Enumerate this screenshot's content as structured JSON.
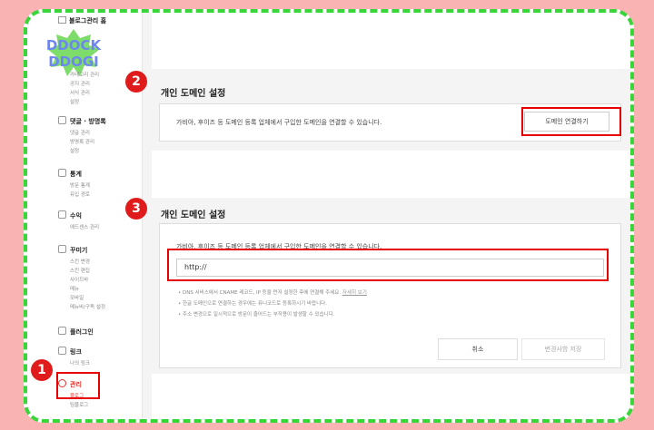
{
  "colors": {
    "accent": "#e01b1b",
    "dash_border": "#39d639",
    "background": "#f9b3b3"
  },
  "sidebar": {
    "home_label": "블로그관리 홈",
    "logo_lines": [
      "DDOCK",
      "DDOGI"
    ],
    "sections": [
      {
        "title": "",
        "items": [
          "카테고리 관리",
          "공지 관리",
          "서식 관리",
          "설정"
        ]
      },
      {
        "title": "댓글 · 방명록",
        "items": [
          "댓글 관리",
          "방명록 관리",
          "설정"
        ]
      },
      {
        "title": "통계",
        "items": [
          "방문 통계",
          "유입 경로"
        ]
      },
      {
        "title": "수익",
        "items": [
          "애드센스 관리"
        ]
      },
      {
        "title": "꾸미기",
        "items": [
          "스킨 변경",
          "스킨 편집",
          "사이드바",
          "메뉴",
          "모바일",
          "메뉴바/구독 설정"
        ]
      },
      {
        "title": "플러그인",
        "items": []
      },
      {
        "title": "링크",
        "items": [
          "나의 링크"
        ]
      },
      {
        "title": "관리",
        "items": [
          "블로그",
          "팀블로그"
        ]
      }
    ]
  },
  "section1": {
    "title": "개인 도메인 설정",
    "description": "가비아, 후이즈 등 도메인 등록 업체에서 구입한 도메인을 연결할 수 있습니다.",
    "connect_button": "도메인 연결하기"
  },
  "section2": {
    "title": "개인 도메인 설정",
    "description": "가비아, 후이즈 등 도메인 등록 업체에서 구입한 도메인을 연결할 수 있습니다.",
    "domain_input_value": "http://",
    "notes": [
      "DNS 서비스에서 CNAME 레코드, IP 등을 먼저 설정한 후에 연결해 주세요.",
      "한글 도메인으로 연결하는 경우에는 퓨니코드로 등록하시기 바랍니다.",
      "주소 변경으로 일시적으로 방문이 줄어드는 부작용이 발생할 수 있습니다."
    ],
    "notes_link": "자세히 보기",
    "cancel_button": "취소",
    "save_button": "변경사항 저장"
  },
  "step_badges": [
    "1",
    "2",
    "3"
  ]
}
